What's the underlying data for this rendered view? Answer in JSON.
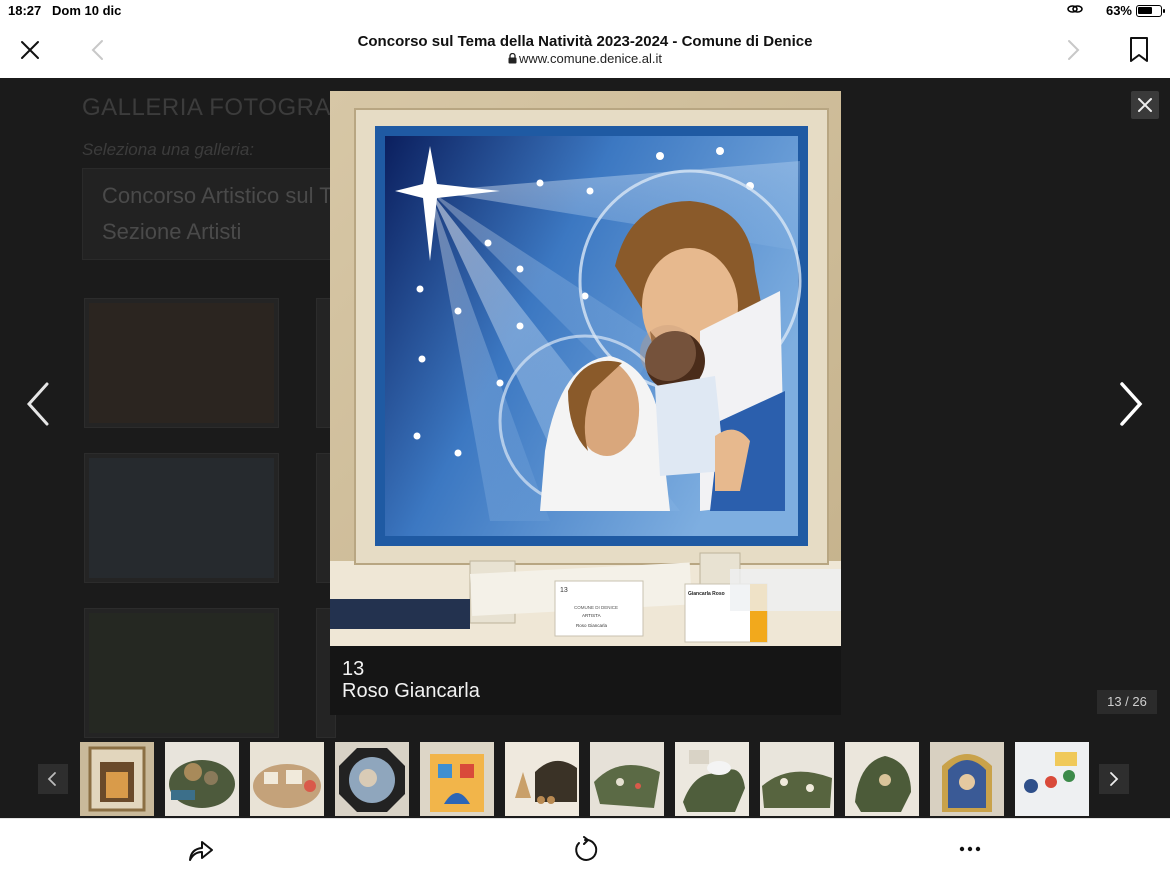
{
  "status_bar": {
    "time": "18:27",
    "date": "Dom 10 dic",
    "battery": "63%",
    "battery_level": 0.63
  },
  "browser": {
    "page_title": "Concorso sul Tema della Natività 2023-2024 - Comune di Denice",
    "url": "www.comune.denice.al.it"
  },
  "background_page": {
    "heading": "GALLERIA FOTOGRAFIC",
    "select_label": "Seleziona una galleria:",
    "select_value_line1": "Concorso Artistico sul T",
    "select_value_line2": "Sezione Artisti"
  },
  "lightbox": {
    "caption_number": "13",
    "caption_name": "Roso Giancarla",
    "counter": "13 / 26",
    "card_left_top": "13",
    "card_left_line1": "COMUNE DI DENICE",
    "card_left_line2": "ARTISTA",
    "card_left_line3": "Roso Giancarla",
    "card_right_name": "Giancarla Roso"
  },
  "colors": {
    "overlay": "#1b1b1b",
    "caption_bg": "#151515",
    "accent": "#f2a91c"
  },
  "thumbnails": [
    {
      "name": "thumb-1"
    },
    {
      "name": "thumb-2"
    },
    {
      "name": "thumb-3"
    },
    {
      "name": "thumb-4"
    },
    {
      "name": "thumb-5"
    },
    {
      "name": "thumb-6"
    },
    {
      "name": "thumb-7"
    },
    {
      "name": "thumb-8"
    },
    {
      "name": "thumb-9"
    },
    {
      "name": "thumb-10"
    },
    {
      "name": "thumb-11"
    },
    {
      "name": "thumb-12"
    }
  ]
}
